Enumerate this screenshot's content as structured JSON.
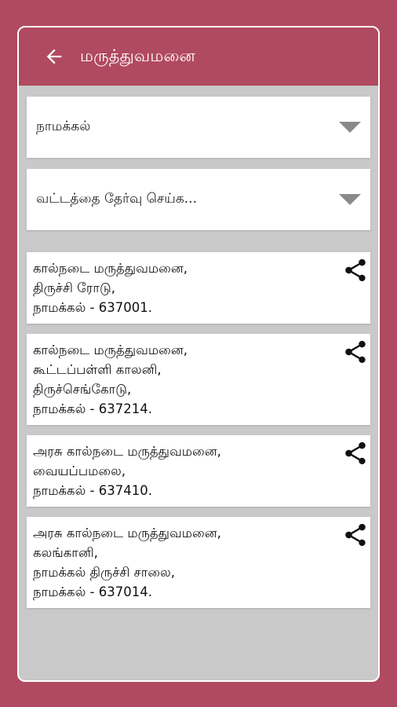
{
  "header": {
    "title": "மருத்துவமனை"
  },
  "filters": {
    "district": "நாமக்கல்",
    "taluk": "வட்டத்தை தேர்வு செய்க..."
  },
  "hospitals": [
    {
      "lines": [
        "கால்நடை மருத்துவமனை,",
        "திருச்சி ரோடு,",
        "நாமக்கல் - 637001."
      ]
    },
    {
      "lines": [
        "கால்நடை மருத்துவமனை,",
        "கூட்டப்பள்ளி காலனி,",
        "திருச்செங்கோடு,",
        "நாமக்கல் - 637214."
      ]
    },
    {
      "lines": [
        "அரசு கால்நடை மருத்துவமனை,",
        "வையப்பமலை,",
        "நாமக்கல் - 637410."
      ]
    },
    {
      "lines": [
        "அரசு கால்நடை மருத்துவமனை,",
        "கலங்கானி,",
        "நாமக்கல் திருச்சி சாலை,",
        "நாமக்கல் - 637014."
      ]
    }
  ]
}
